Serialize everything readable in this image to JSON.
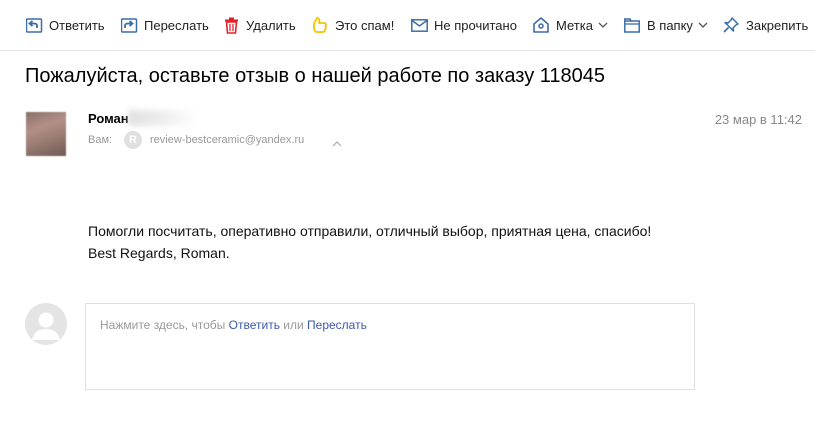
{
  "toolbar": {
    "reply_label": "Ответить",
    "forward_label": "Переслать",
    "delete_label": "Удалить",
    "spam_label": "Это спам!",
    "unread_label": "Не прочитано",
    "label_label": "Метка",
    "folder_label": "В папку",
    "pin_label": "Закрепить"
  },
  "message": {
    "subject": "Пожалуйста, оставьте отзыв о нашей работе по заказу 118045",
    "sender_name": "Роман",
    "to_label": "Вам:",
    "to_avatar_letter": "R",
    "to_email": "review-bestceramic@yandex.ru",
    "date": "23 мар в 11:42",
    "body_line1": "Помогли посчитать, оперативно отправили, отличный выбор, приятная цена, спасибо!",
    "body_line2": "Best Regards, Roman."
  },
  "reply": {
    "prefix": "Нажмите здесь, чтобы ",
    "reply_link": "Ответить",
    "or_text": " или ",
    "forward_link": "Переслать"
  },
  "colors": {
    "icon_blue": "#3a6ea8",
    "delete_red": "#e0242b",
    "spam_yellow": "#f5c400",
    "link_blue": "#3a5aa8"
  }
}
